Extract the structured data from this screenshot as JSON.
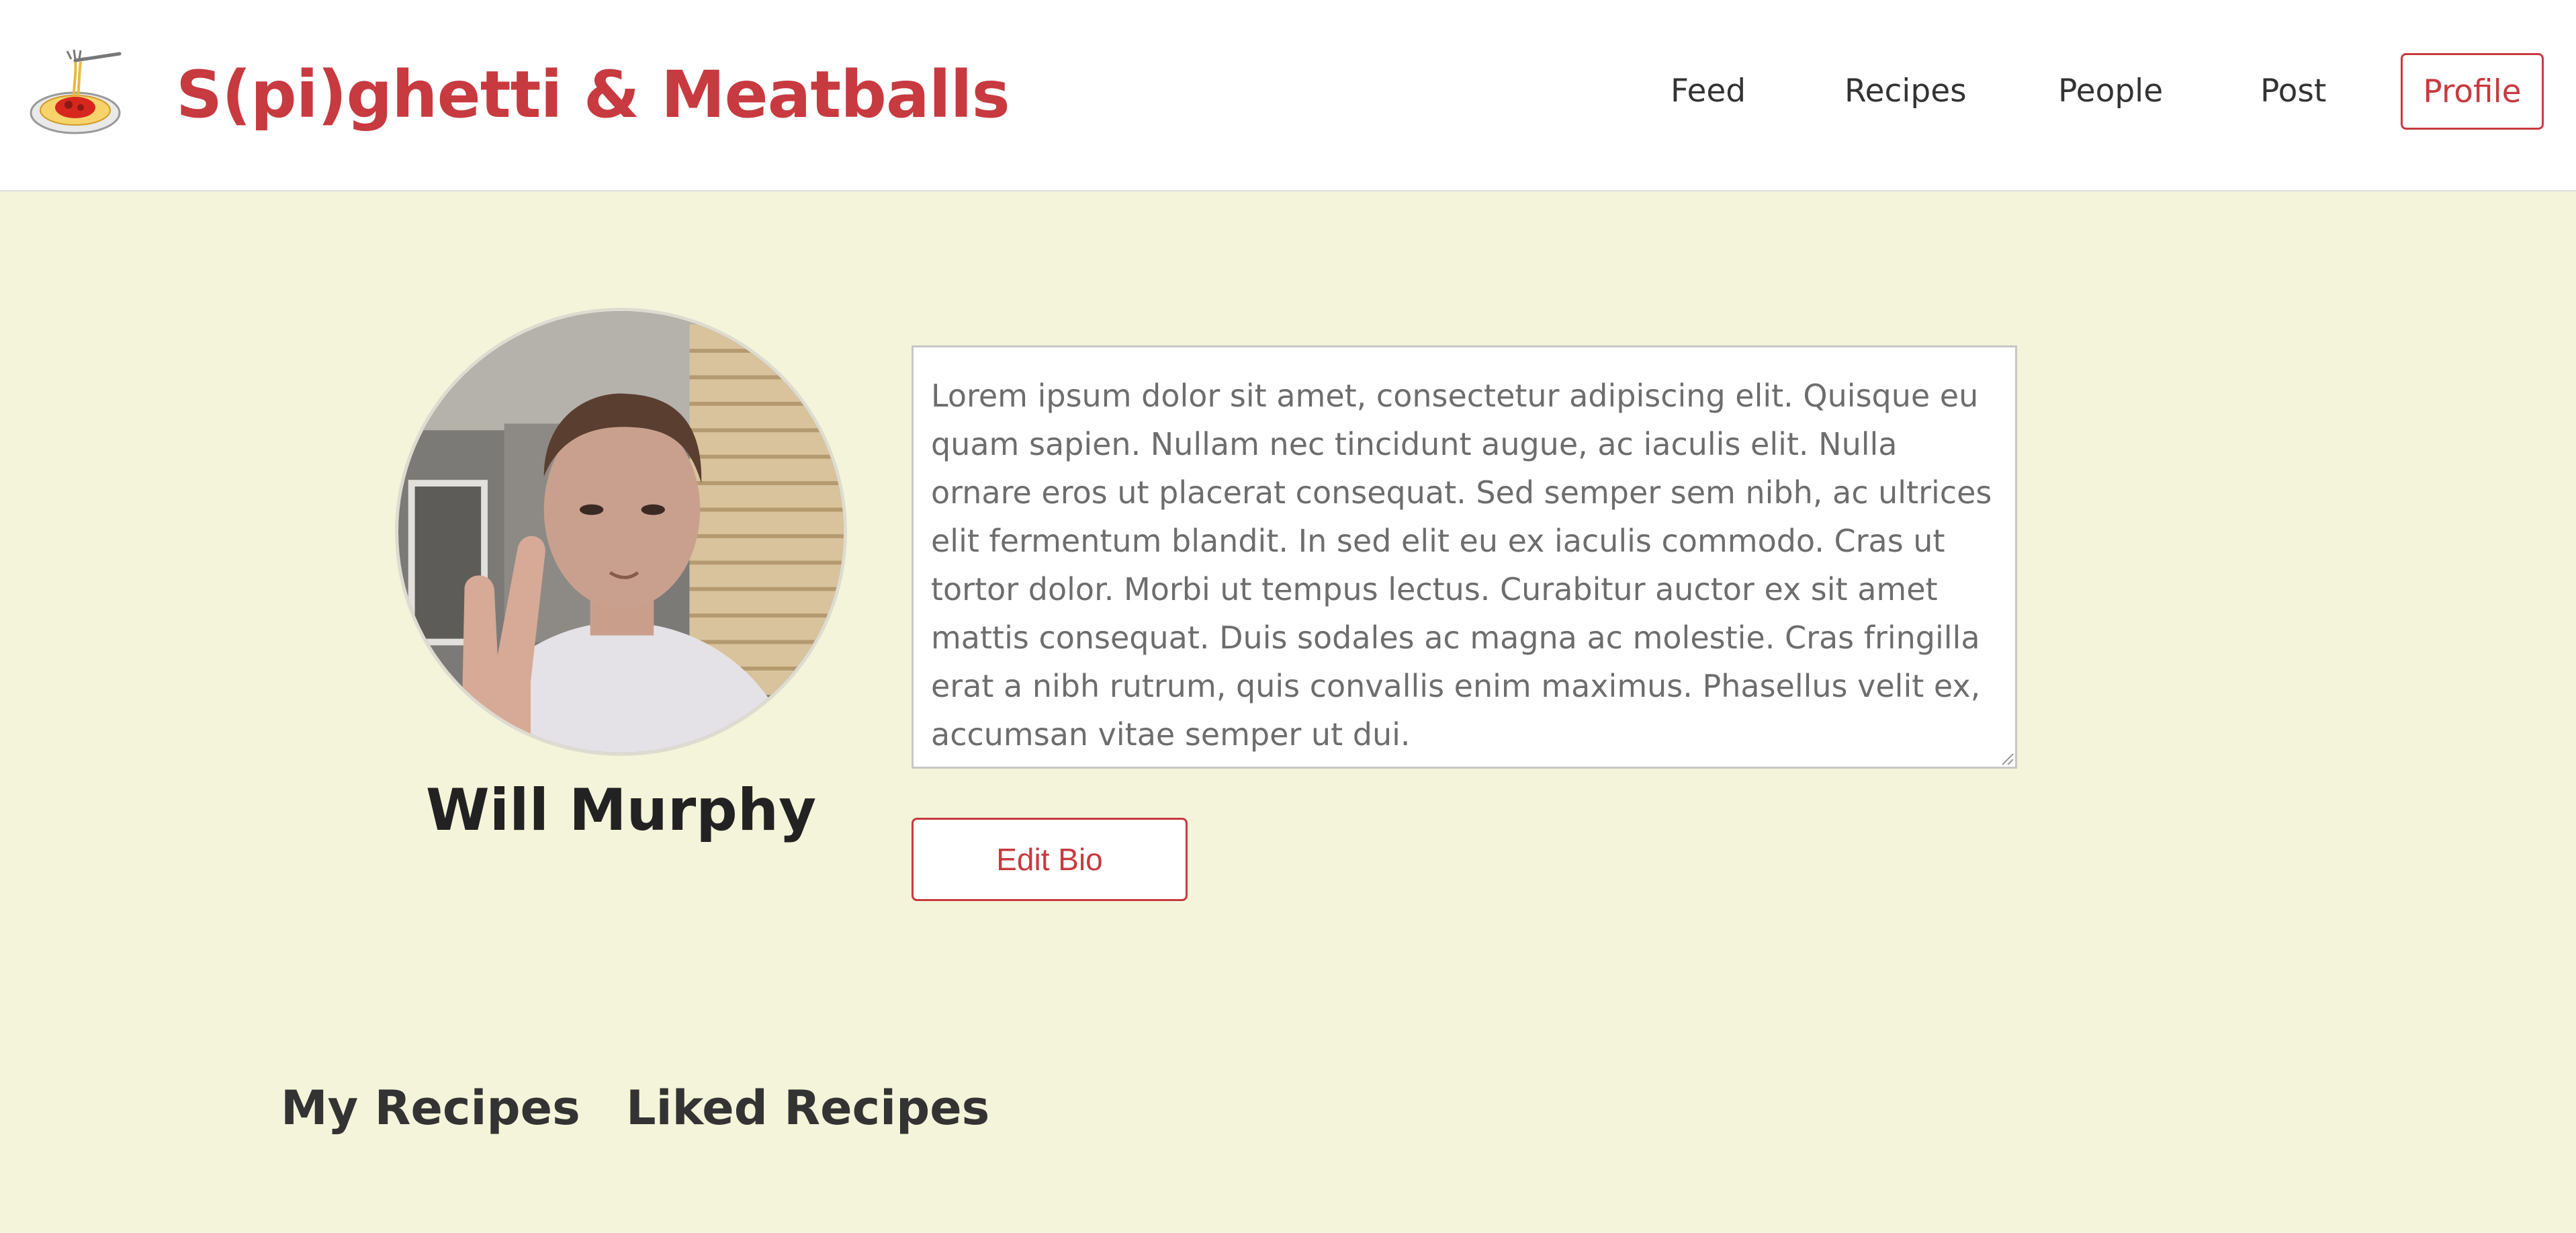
{
  "header": {
    "logo_icon": "spaghetti-plate-icon",
    "brand_title": "S(pi)ghetti & Meatballs",
    "nav": {
      "feed": "Feed",
      "recipes": "Recipes",
      "people": "People",
      "post": "Post",
      "profile": "Profile"
    }
  },
  "profile": {
    "avatar_icon": "profile-photo",
    "name": "Will Murphy",
    "bio": "Lorem ipsum dolor sit amet, consectetur adipiscing elit. Quisque eu quam sapien. Nullam nec tincidunt augue, ac iaculis elit. Nulla ornare eros ut placerat consequat. Sed semper sem nibh, ac ultrices elit fermentum blandit. In sed elit eu ex iaculis commodo. Cras ut tortor dolor. Morbi ut tempus lectus. Curabitur auctor ex sit amet mattis consequat. Duis sodales ac magna ac molestie. Cras fringilla erat a nibh rutrum, quis convallis enim maximus. Phasellus velit ex, accumsan vitae semper ut dui.",
    "edit_bio_label": "Edit Bio"
  },
  "tabs": {
    "my_recipes": "My Recipes",
    "liked_recipes": "Liked Recipes"
  },
  "colors": {
    "brand_red": "#c73a3f",
    "page_background": "#f4f4da",
    "navbar_background": "#ffffff"
  }
}
